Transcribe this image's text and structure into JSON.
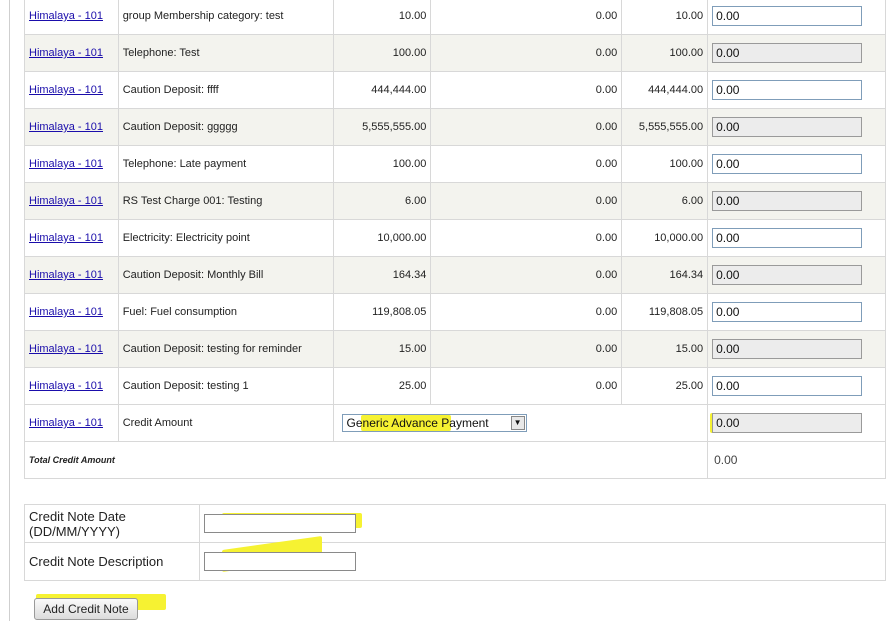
{
  "rows": [
    {
      "unit": "Himalaya - 101",
      "description": "group Membership category: test",
      "amount": "10.00",
      "paid": "0.00",
      "due": "10.00",
      "credit": "0.00"
    },
    {
      "unit": "Himalaya - 101",
      "description": "Telephone: Test",
      "amount": "100.00",
      "paid": "0.00",
      "due": "100.00",
      "credit": "0.00"
    },
    {
      "unit": "Himalaya - 101",
      "description": "Caution Deposit: ffff",
      "amount": "444,444.00",
      "paid": "0.00",
      "due": "444,444.00",
      "credit": "0.00"
    },
    {
      "unit": "Himalaya - 101",
      "description": "Caution Deposit: ggggg",
      "amount": "5,555,555.00",
      "paid": "0.00",
      "due": "5,555,555.00",
      "credit": "0.00"
    },
    {
      "unit": "Himalaya - 101",
      "description": "Telephone: Late payment",
      "amount": "100.00",
      "paid": "0.00",
      "due": "100.00",
      "credit": "0.00"
    },
    {
      "unit": "Himalaya - 101",
      "description": "RS Test Charge 001: Testing",
      "amount": "6.00",
      "paid": "0.00",
      "due": "6.00",
      "credit": "0.00"
    },
    {
      "unit": "Himalaya - 101",
      "description": "Electricity: Electricity point",
      "amount": "10,000.00",
      "paid": "0.00",
      "due": "10,000.00",
      "credit": "0.00"
    },
    {
      "unit": "Himalaya - 101",
      "description": "Caution Deposit: Monthly Bill",
      "amount": "164.34",
      "paid": "0.00",
      "due": "164.34",
      "credit": "0.00"
    },
    {
      "unit": "Himalaya - 101",
      "description": "Fuel: Fuel consumption",
      "amount": "119,808.05",
      "paid": "0.00",
      "due": "119,808.05",
      "credit": "0.00"
    },
    {
      "unit": "Himalaya - 101",
      "description": "Caution Deposit: testing for reminder",
      "amount": "15.00",
      "paid": "0.00",
      "due": "15.00",
      "credit": "0.00"
    },
    {
      "unit": "Himalaya - 101",
      "description": "Caution Deposit: testing 1",
      "amount": "25.00",
      "paid": "0.00",
      "due": "25.00",
      "credit": "0.00"
    }
  ],
  "credit_row": {
    "unit": "Himalaya - 101",
    "label": "Credit Amount",
    "payment_type": "Generic Advance Payment",
    "value": "0.00"
  },
  "total": {
    "label": "Total Credit Amount",
    "value": "0.00"
  },
  "form": {
    "date_label": "Credit Note Date (DD/MM/YYYY)",
    "date_value": "",
    "description_label": "Credit Note Description",
    "description_value": ""
  },
  "add_button": "Add Credit Note",
  "colors": {
    "highlight": "#f6f232",
    "link": "#1a0dab",
    "alt_row": "#f3f3ee"
  }
}
